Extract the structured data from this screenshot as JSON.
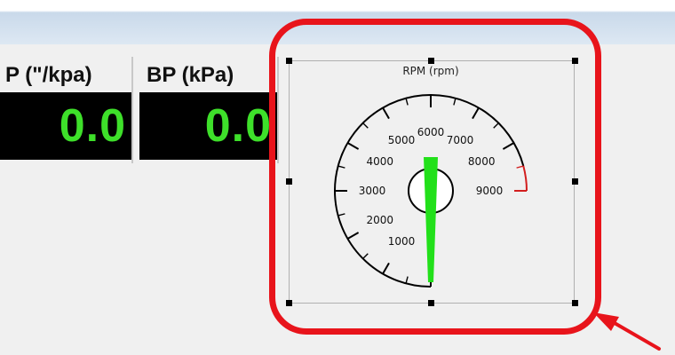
{
  "gauges": [
    {
      "label": "P (\"/kpa)",
      "value": "0.0"
    },
    {
      "label": "BP (kPa)",
      "value": "0.0"
    }
  ],
  "tachometer": {
    "title": "RPM (rpm)",
    "scale_labels": [
      "1000",
      "2000",
      "3000",
      "4000",
      "5000",
      "6000",
      "7000",
      "8000",
      "9000"
    ],
    "value_rpm": 0,
    "range_min": 0,
    "range_max": 9000,
    "redline_from": 8500
  },
  "colors": {
    "digit_green": "#3ee02a",
    "needle_green": "#22e01a",
    "redline": "#d21e1e",
    "highlight_red": "#e8141b"
  },
  "annotation": {
    "highlight": "rounded-rectangle",
    "pointer": "arrow"
  }
}
